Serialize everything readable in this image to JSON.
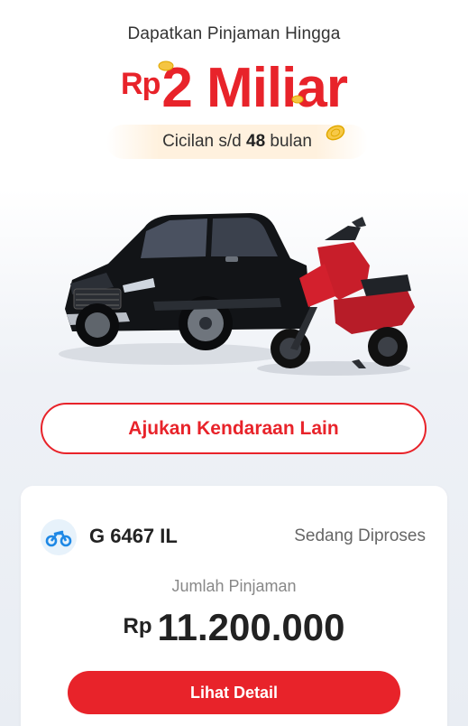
{
  "promo": {
    "subtitle": "Dapatkan Pinjaman Hingga",
    "currency": "Rp",
    "amount": "2 Miliar",
    "installment_prefix": "Cicilan s/d",
    "installment_months": "48",
    "installment_suffix": "bulan"
  },
  "apply_other_button": "Ajukan Kendaraan Lain",
  "loan_card": {
    "vehicle_icon": "motorcycle-icon",
    "plate": "G 6467 IL",
    "status": "Sedang Diproses",
    "amount_label": "Jumlah Pinjaman",
    "currency": "Rp",
    "amount": "11.200.000",
    "detail_button": "Lihat Detail"
  },
  "colors": {
    "accent": "#e8232a",
    "icon_bg": "#e7f2fb",
    "icon_fg": "#1e88e5"
  }
}
